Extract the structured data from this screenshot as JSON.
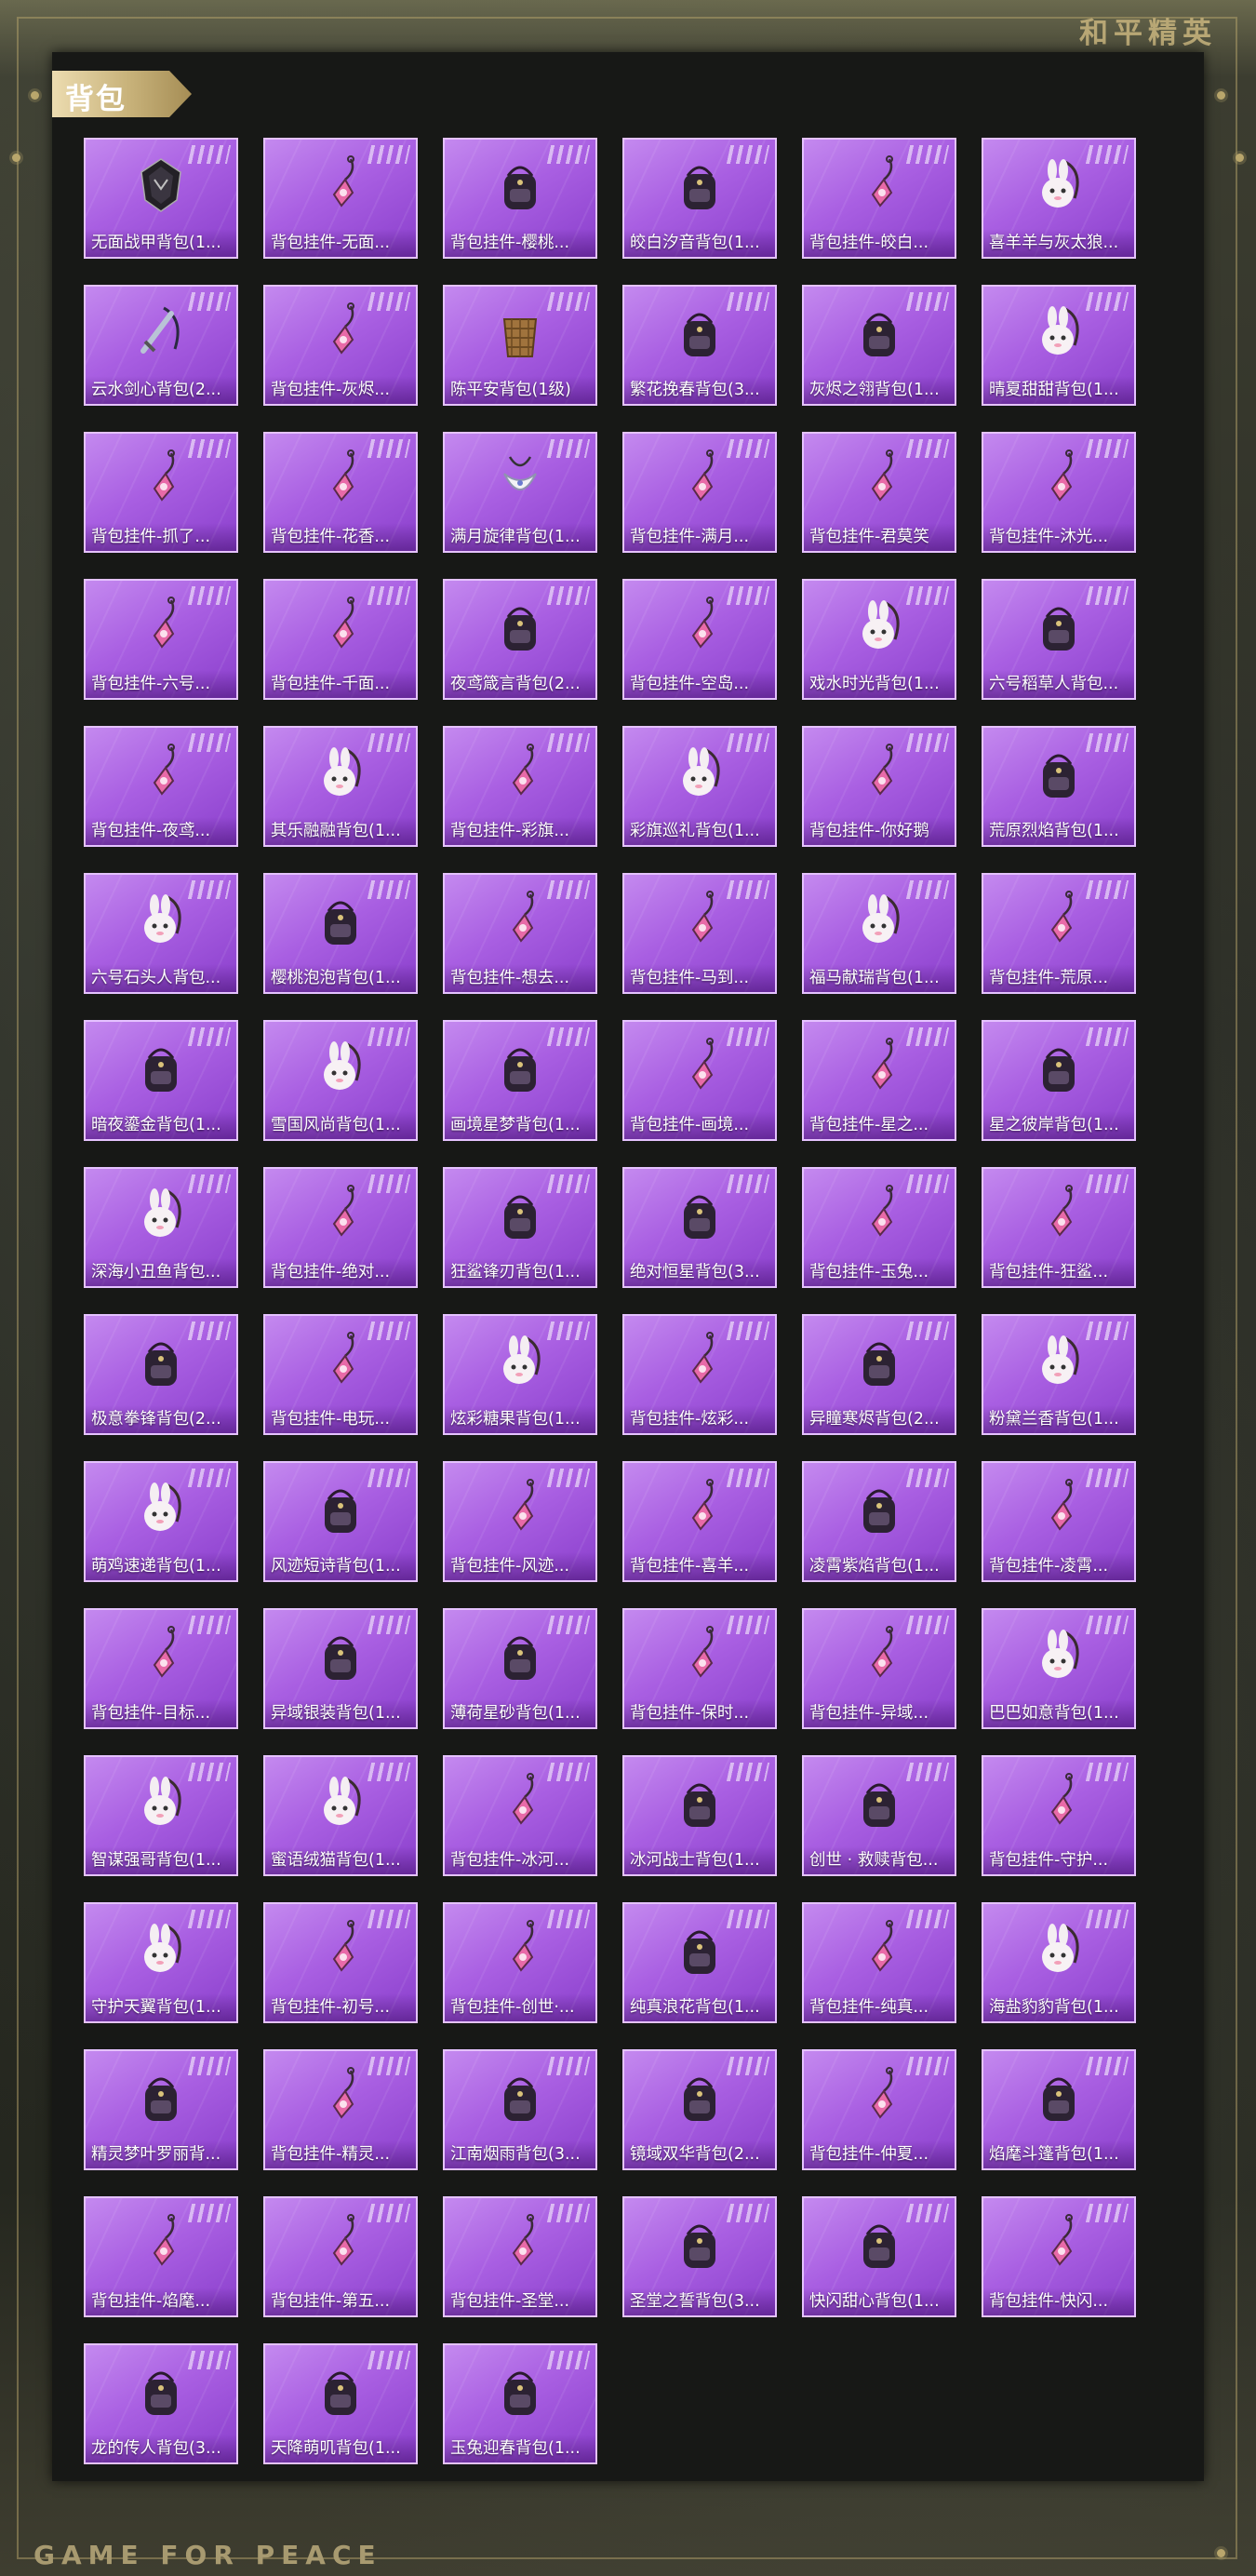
{
  "brand": "和平精英",
  "section": {
    "title": "背包"
  },
  "footer": "GAME FOR PEACE",
  "colors": {
    "card_top": "#c489ef",
    "card_bottom": "#8a3fcc",
    "card_border": "#e5c2ff",
    "tab_gold": "#c8b27a",
    "brand_gold": "#b8a775"
  },
  "items": [
    {
      "name": "无面战甲背包(1...",
      "icon": "armor-backpack-icon"
    },
    {
      "name": "背包挂件-无面...",
      "icon": "pendant-icon"
    },
    {
      "name": "背包挂件-樱桃...",
      "icon": "cherry-pendant-icon"
    },
    {
      "name": "皎白汐音背包(1...",
      "icon": "backpack-icon"
    },
    {
      "name": "背包挂件-皎白...",
      "icon": "pendant-icon"
    },
    {
      "name": "喜羊羊与灰太狼...",
      "icon": "plush-backpack-icon"
    },
    {
      "name": "云水剑心背包(2...",
      "icon": "sword-backpack-icon"
    },
    {
      "name": "背包挂件-灰烬...",
      "icon": "pendant-icon"
    },
    {
      "name": "陈平安背包(1级)",
      "icon": "basket-backpack-icon"
    },
    {
      "name": "繁花挽春背包(3...",
      "icon": "backpack-icon"
    },
    {
      "name": "灰烬之翎背包(1...",
      "icon": "backpack-icon"
    },
    {
      "name": "晴夏甜甜背包(1...",
      "icon": "plush-backpack-icon"
    },
    {
      "name": "背包挂件-抓了...",
      "icon": "pendant-icon"
    },
    {
      "name": "背包挂件-花香...",
      "icon": "pendant-icon"
    },
    {
      "name": "满月旋律背包(1...",
      "icon": "moon-backpack-icon"
    },
    {
      "name": "背包挂件-满月...",
      "icon": "pendant-icon"
    },
    {
      "name": "背包挂件-君莫笑",
      "icon": "pendant-icon"
    },
    {
      "name": "背包挂件-沐光...",
      "icon": "pendant-icon"
    },
    {
      "name": "背包挂件-六号...",
      "icon": "pendant-icon"
    },
    {
      "name": "背包挂件-千面...",
      "icon": "pendant-icon"
    },
    {
      "name": "夜鸢箴言背包(2...",
      "icon": "backpack-icon"
    },
    {
      "name": "背包挂件-空岛...",
      "icon": "pendant-icon"
    },
    {
      "name": "戏水时光背包(1...",
      "icon": "plush-backpack-icon"
    },
    {
      "name": "六号稻草人背包...",
      "icon": "backpack-icon"
    },
    {
      "name": "背包挂件-夜鸢...",
      "icon": "pendant-icon"
    },
    {
      "name": "其乐融融背包(1...",
      "icon": "plush-backpack-icon"
    },
    {
      "name": "背包挂件-彩旗...",
      "icon": "pendant-icon"
    },
    {
      "name": "彩旗巡礼背包(1...",
      "icon": "plush-backpack-icon"
    },
    {
      "name": "背包挂件-你好鹅",
      "icon": "pendant-icon"
    },
    {
      "name": "荒原烈焰背包(1...",
      "icon": "backpack-icon"
    },
    {
      "name": "六号石头人背包...",
      "icon": "plush-backpack-icon"
    },
    {
      "name": "樱桃泡泡背包(1...",
      "icon": "backpack-icon"
    },
    {
      "name": "背包挂件-想去...",
      "icon": "pendant-icon"
    },
    {
      "name": "背包挂件-马到...",
      "icon": "pendant-icon"
    },
    {
      "name": "福马献瑞背包(1...",
      "icon": "plush-backpack-icon"
    },
    {
      "name": "背包挂件-荒原...",
      "icon": "pendant-icon"
    },
    {
      "name": "暗夜鎏金背包(1...",
      "icon": "backpack-icon"
    },
    {
      "name": "雪国风尚背包(1...",
      "icon": "plush-backpack-icon"
    },
    {
      "name": "画境星梦背包(1...",
      "icon": "backpack-icon"
    },
    {
      "name": "背包挂件-画境...",
      "icon": "pendant-icon"
    },
    {
      "name": "背包挂件-星之...",
      "icon": "pendant-icon"
    },
    {
      "name": "星之彼岸背包(1...",
      "icon": "backpack-icon"
    },
    {
      "name": "深海小丑鱼背包...",
      "icon": "plush-backpack-icon"
    },
    {
      "name": "背包挂件-绝对...",
      "icon": "pendant-icon"
    },
    {
      "name": "狂鲨锋刃背包(1...",
      "icon": "backpack-icon"
    },
    {
      "name": "绝对恒星背包(3...",
      "icon": "backpack-icon"
    },
    {
      "name": "背包挂件-玉兔...",
      "icon": "pendant-icon"
    },
    {
      "name": "背包挂件-狂鲨...",
      "icon": "pendant-icon"
    },
    {
      "name": "极意拳锋背包(2...",
      "icon": "backpack-icon"
    },
    {
      "name": "背包挂件-电玩...",
      "icon": "pendant-icon"
    },
    {
      "name": "炫彩糖果背包(1...",
      "icon": "plush-backpack-icon"
    },
    {
      "name": "背包挂件-炫彩...",
      "icon": "pendant-icon"
    },
    {
      "name": "异瞳寒烬背包(2...",
      "icon": "backpack-icon"
    },
    {
      "name": "粉黛兰香背包(1...",
      "icon": "plush-backpack-icon"
    },
    {
      "name": "萌鸡速递背包(1...",
      "icon": "plush-backpack-icon"
    },
    {
      "name": "风迹短诗背包(1...",
      "icon": "backpack-icon"
    },
    {
      "name": "背包挂件-风迹...",
      "icon": "pendant-icon"
    },
    {
      "name": "背包挂件-喜羊...",
      "icon": "pendant-icon"
    },
    {
      "name": "凌霄紫焰背包(1...",
      "icon": "backpack-icon"
    },
    {
      "name": "背包挂件-凌霄...",
      "icon": "pendant-icon"
    },
    {
      "name": "背包挂件-目标...",
      "icon": "pendant-icon"
    },
    {
      "name": "异域银装背包(1...",
      "icon": "backpack-icon"
    },
    {
      "name": "薄荷星砂背包(1...",
      "icon": "backpack-icon"
    },
    {
      "name": "背包挂件-保时...",
      "icon": "pendant-icon"
    },
    {
      "name": "背包挂件-异域...",
      "icon": "pendant-icon"
    },
    {
      "name": "巴巴如意背包(1...",
      "icon": "plush-backpack-icon"
    },
    {
      "name": "智谋强哥背包(1...",
      "icon": "plush-backpack-icon"
    },
    {
      "name": "蜜语绒猫背包(1...",
      "icon": "plush-backpack-icon"
    },
    {
      "name": "背包挂件-冰河...",
      "icon": "pendant-icon"
    },
    {
      "name": "冰河战士背包(1...",
      "icon": "backpack-icon"
    },
    {
      "name": "创世 · 救赎背包...",
      "icon": "backpack-icon"
    },
    {
      "name": "背包挂件-守护...",
      "icon": "pendant-icon"
    },
    {
      "name": "守护天翼背包(1...",
      "icon": "plush-backpack-icon"
    },
    {
      "name": "背包挂件-初号...",
      "icon": "pendant-icon"
    },
    {
      "name": "背包挂件-创世·...",
      "icon": "pendant-icon"
    },
    {
      "name": "纯真浪花背包(1...",
      "icon": "backpack-icon"
    },
    {
      "name": "背包挂件-纯真...",
      "icon": "pendant-icon"
    },
    {
      "name": "海盐豹豹背包(1...",
      "icon": "plush-backpack-icon"
    },
    {
      "name": "精灵梦叶罗丽背...",
      "icon": "backpack-icon"
    },
    {
      "name": "背包挂件-精灵...",
      "icon": "pendant-icon"
    },
    {
      "name": "江南烟雨背包(3...",
      "icon": "backpack-icon"
    },
    {
      "name": "镜域双华背包(2...",
      "icon": "backpack-icon"
    },
    {
      "name": "背包挂件-仲夏...",
      "icon": "pendant-icon"
    },
    {
      "name": "焰麾斗篷背包(1...",
      "icon": "backpack-icon"
    },
    {
      "name": "背包挂件-焰麾...",
      "icon": "pendant-icon"
    },
    {
      "name": "背包挂件-第五...",
      "icon": "pendant-icon"
    },
    {
      "name": "背包挂件-圣堂...",
      "icon": "pendant-icon"
    },
    {
      "name": "圣堂之誓背包(3...",
      "icon": "backpack-icon"
    },
    {
      "name": "快闪甜心背包(1...",
      "icon": "backpack-icon"
    },
    {
      "name": "背包挂件-快闪...",
      "icon": "pendant-icon"
    },
    {
      "name": "龙的传人背包(3...",
      "icon": "backpack-icon"
    },
    {
      "name": "天降萌叽背包(1...",
      "icon": "backpack-icon"
    },
    {
      "name": "玉兔迎春背包(1...",
      "icon": "backpack-icon"
    }
  ]
}
